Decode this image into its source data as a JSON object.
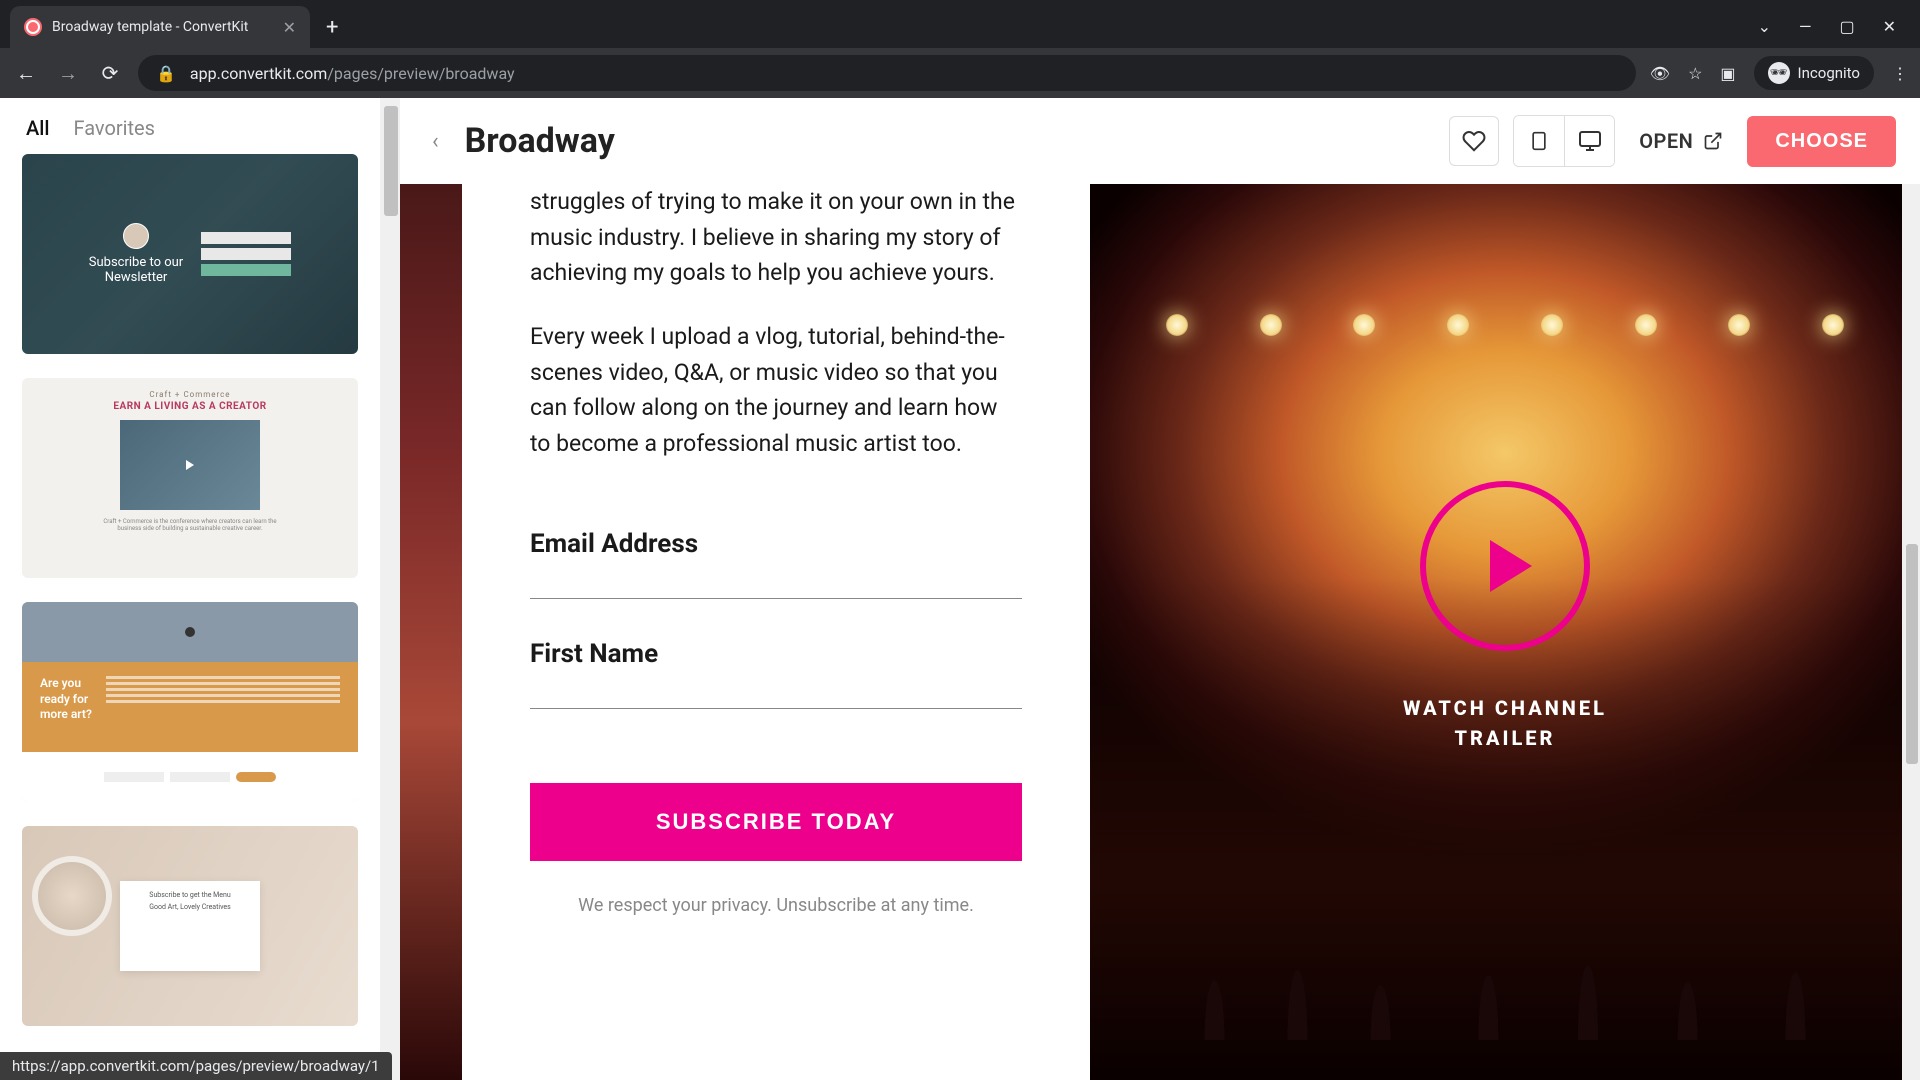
{
  "browser": {
    "tab_title": "Broadway template - ConvertKit",
    "url_domain": "app.convertkit.com",
    "url_path": "/pages/preview/broadway",
    "incognito_label": "Incognito",
    "status_url": "https://app.convertkit.com/pages/preview/broadway/1"
  },
  "sidebar": {
    "tabs": {
      "all": "All",
      "favorites": "Favorites"
    },
    "thumbs": {
      "t1_line1": "Subscribe to our",
      "t1_line2": "Newsletter",
      "t2_sub": "Craft + Commerce",
      "t2_title": "EARN A LIVING AS A CREATOR",
      "t3_q1": "Are you",
      "t3_q2": "ready for",
      "t3_q3": "more art?",
      "t4_l1": "Subscribe to get the Menu",
      "t4_l2": "Good Art, Lovely Creatives"
    }
  },
  "header": {
    "title": "Broadway",
    "open": "OPEN",
    "choose": "CHOOSE"
  },
  "preview": {
    "para1": "struggles of trying to make it on your own in the music industry. I believe in sharing my story of achieving my goals to help you achieve yours.",
    "para2": "Every week I upload a vlog, tutorial, behind-the-scenes video, Q&A, or music video so that you can follow along on the journey and learn how to become a professional music artist too.",
    "email_label": "Email Address",
    "name_label": "First Name",
    "subscribe": "SUBSCRIBE TODAY",
    "privacy": "We respect your privacy. Unsubscribe at any time.",
    "watch_l1": "WATCH CHANNEL",
    "watch_l2": "TRAILER"
  }
}
